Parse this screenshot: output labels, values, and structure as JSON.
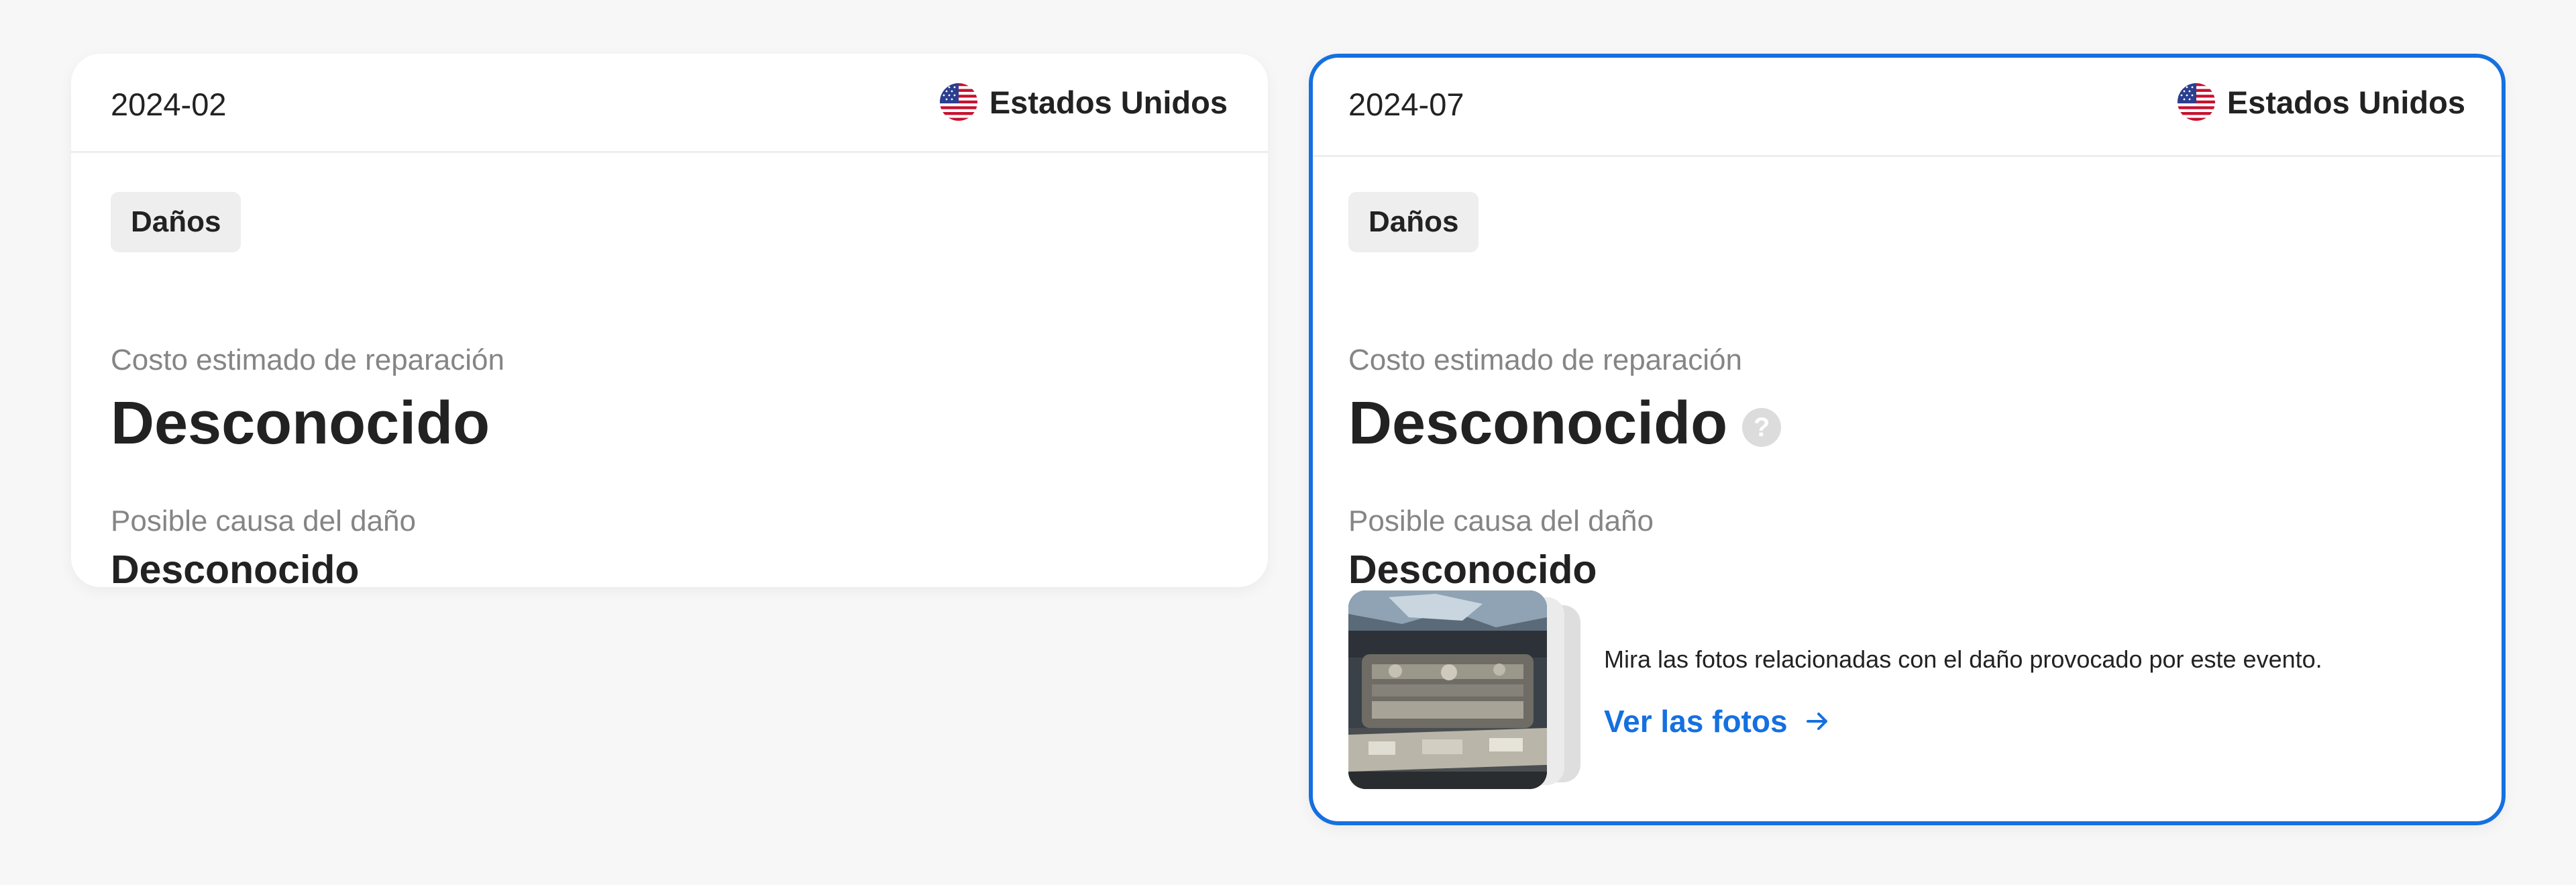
{
  "cards": [
    {
      "date": "2024-02",
      "country": "Estados Unidos",
      "tag": "Daños",
      "cost_label": "Costo estimado de reparación",
      "cost_value": "Desconocido",
      "cause_label": "Posible causa del daño",
      "cause_value": "Desconocido"
    },
    {
      "date": "2024-07",
      "country": "Estados Unidos",
      "tag": "Daños",
      "cost_label": "Costo estimado de reparación",
      "cost_value": "Desconocido",
      "help_icon": "?",
      "cause_label": "Posible causa del daño",
      "cause_value": "Desconocido",
      "photos_text": "Mira las fotos relacionadas con el daño provocado por este evento.",
      "photos_link": "Ver las fotos"
    }
  ],
  "icons": {
    "flag": "us-flag-icon",
    "help": "help-circle-icon",
    "arrow": "arrow-right-icon",
    "photo": "damaged-engine-photo"
  },
  "colors": {
    "accent": "#1570e0",
    "background": "#f7f7f7",
    "card": "#ffffff",
    "label": "#858585",
    "tag": "#eeeeee"
  }
}
